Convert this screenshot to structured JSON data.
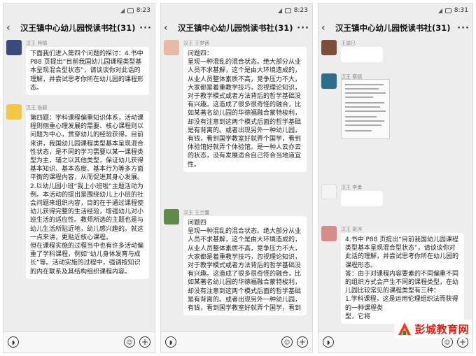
{
  "panels": [
    {
      "time": "8:23",
      "title": "汉王镇中心幼儿园悦读书社(31)",
      "messages": [
        {
          "sender": "汉王 熊晴",
          "text": "下面我们进入第四个问题的探讨：4.书中 P88 页提出“目前我国幼儿园课程类型基本呈现混合型状态”，请谈谈你对此话的理解，并尝试思考你所在幼儿园的课程形态。"
        },
        {
          "sender": "汉王 张颖",
          "text": "第四题：学科课程偏重知识体系，活动课程则侧重心理发展的需要、核心课程则以问题为中心，贯穿幼儿的经验获得。目前来讲，我国幼儿园课程类型基本呈现混合性状态，是不同的学习需要以某一课程类型为主，辅之以其他类型，保证幼儿获得基本知识、基本态度、基本行为等多方面平衡的课程内容，从而促进其身心发展。\n2.以幼儿园小班“我上小班啦”主题活动为例。本活动的提出是围绕幼儿上小班的社会问题来组织内容，目的在于通过课程使幼儿获得完整的生活经验，增强幼儿对小班生活的适应性。教师所选的主题也是与幼儿生活所贴近地，幼儿感兴趣的。就这一点来讲，更贴近核心课程。\n但在课程实施的过程当中也有许多活动偏重了学科课程，例如“幼儿身体发育与成长”等。活动实施的过程中，强调按知识的内在联系及其结构组织课程内容。"
        }
      ]
    },
    {
      "time": "8:23",
      "title": "汉王镇中心幼儿园悦读书社(31)",
      "messages": [
        {
          "sender": "汉王 王梦茜",
          "text": "问题四：\n呈现一种混乱的混合状态。绝大部分从业人员不求甚解，这个是由大环境造成的，从业人员整体素质不高，竞争压力不大，大家都是着重教学技巧，忽视理论知识，对于教学模式或者方法背后的哲学基础没有兴趣。这造成了很多很奇怪的融合，比如某著名幼儿园的华德福融合蒙特梭利，却没有注意到这两个模式后面的哲学基础是有背离的。或者出现另外一种幼儿园，有钱，看到国学教室好就弄个国学，看到体验馆好就弄个体验馆。是一种人云亦云的状态，没有发展适合自己符合当地道宜性。"
        },
        {
          "sender": "汉王 王兰馨",
          "text": "问题四\n呈现一种混乱的混合状态。绝大部分从业人员不求甚解，这个是由大环境造成的，从业人员整体素质不高，竞争压力不大，大家都是着重教学技巧，忽视理论知识，对于教学模式或者方法背后的哲学基础没有兴趣。这造成了很多很奇怪的融合，比如某著名幼儿园的华德福融合蒙特梭利，却没有注意到这两个模式后面的哲学基础是有背离的。或者出现另外一种幼儿园，有钱，看到国学教室好就弄个国学，看到"
        }
      ]
    },
    {
      "time": "8:31",
      "title": "汉王镇中心幼儿园悦读书社(31)",
      "messages": [
        {
          "sender": "王滋巳",
          "text": ""
        },
        {
          "sender": "汉王 蔡婧",
          "text": ""
        },
        {
          "sender": "汉王 李勇",
          "text": ""
        },
        {
          "sender": "汉王 斑淬",
          "text": "4.书中 P88 页提出“目前我国幼儿园课程类型基本呈现混合型状态”，请谈谈你对此话的理解，并尝试思考你所在幼儿园的课程形态。\n答：由于对课程内容要素的不同偏重不同的组织方式会产生不同的课程类型，在幼儿园比较常见的课程类型有三种：\n1.学科课程，这是运用伦理组织法而获得的一种课程类\n型，它将"
        }
      ]
    }
  ],
  "watermark": {
    "text": "彭城教育网"
  },
  "icons": {
    "back": "back-arrow-icon",
    "more": "more-dots-icon",
    "voice": "voice-icon",
    "emoji": "emoji-icon",
    "plus": "plus-icon"
  },
  "colors": {
    "bubble": "#ffffff",
    "chat_bg": "#ededed",
    "watermark": "#d91e18"
  }
}
